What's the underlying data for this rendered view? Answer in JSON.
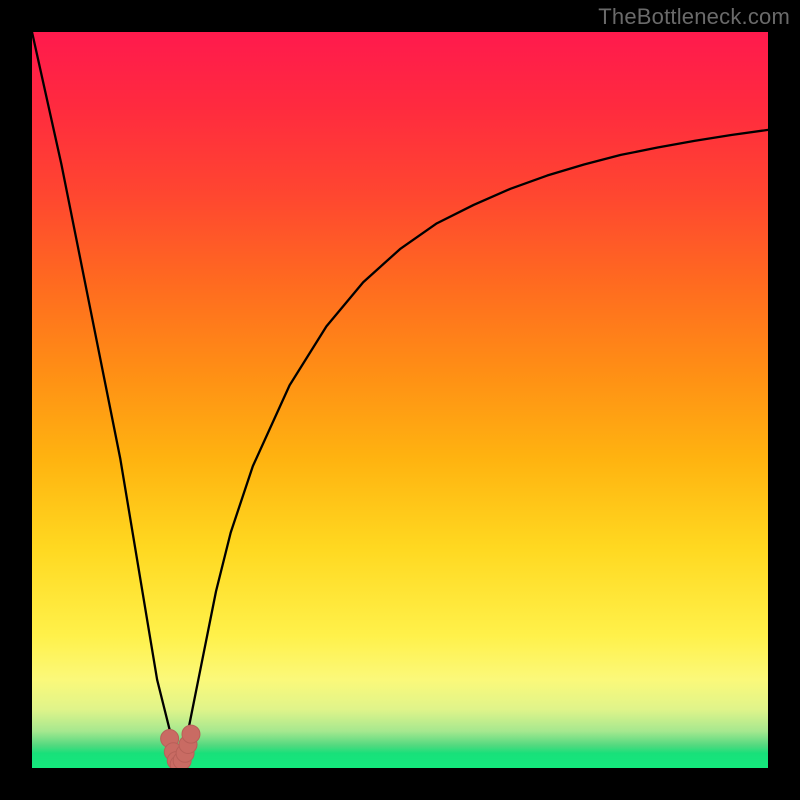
{
  "watermark": {
    "text": "TheBottleneck.com"
  },
  "colors": {
    "frame": "#000000",
    "curve_stroke": "#000000",
    "marker_fill": "#c96b63",
    "marker_stroke": "#b85f58"
  },
  "chart_data": {
    "type": "line",
    "title": "",
    "xlabel": "",
    "ylabel": "",
    "xlim": [
      0,
      100
    ],
    "ylim": [
      0,
      100
    ],
    "grid": false,
    "legend": false,
    "series": [
      {
        "name": "bottleneck-curve",
        "x": [
          0,
          2,
          4,
          6,
          8,
          10,
          12,
          14,
          16,
          17,
          18,
          19,
          19.5,
          20,
          20.5,
          21,
          22,
          23,
          24,
          25,
          27,
          30,
          35,
          40,
          45,
          50,
          55,
          60,
          65,
          70,
          75,
          80,
          85,
          90,
          95,
          100
        ],
        "values": [
          100,
          91,
          82,
          72,
          62,
          52,
          42,
          30,
          18,
          12,
          8,
          4,
          1.5,
          0.5,
          1.5,
          4,
          9,
          14,
          19,
          24,
          32,
          41,
          52,
          60,
          66,
          70.5,
          74,
          76.5,
          78.7,
          80.5,
          82,
          83.3,
          84.3,
          85.2,
          86,
          86.7
        ]
      }
    ],
    "markers": {
      "name": "minimum-band",
      "x": [
        18.7,
        19.2,
        19.6,
        20.0,
        20.4,
        20.8,
        21.2,
        21.6
      ],
      "values": [
        4.0,
        2.2,
        1.0,
        0.5,
        1.0,
        2.0,
        3.2,
        4.6
      ]
    }
  }
}
